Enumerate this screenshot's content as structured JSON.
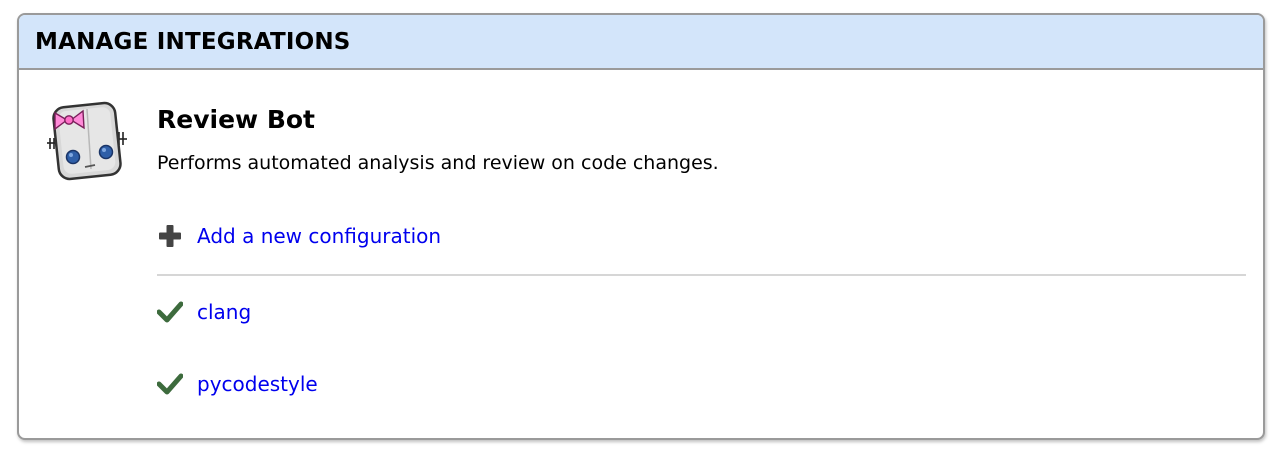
{
  "panel": {
    "title": "MANAGE INTEGRATIONS"
  },
  "integration": {
    "name": "Review Bot",
    "description": "Performs automated analysis and review on code changes.",
    "icon": "review-bot-robot-icon"
  },
  "actions": {
    "add_label": "Add a new configuration",
    "add_icon": "plus-icon"
  },
  "configurations": [
    {
      "name": "clang",
      "status_icon": "check-icon",
      "enabled": true
    },
    {
      "name": "pycodestyle",
      "status_icon": "check-icon",
      "enabled": true
    }
  ],
  "colors": {
    "header_bg": "#d3e5fa",
    "link": "#0000ee",
    "check": "#3d6b3d",
    "plus": "#444444",
    "border": "#9a9a9a"
  }
}
